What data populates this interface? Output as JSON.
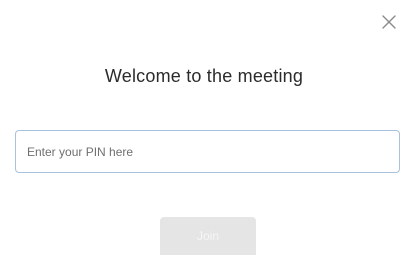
{
  "dialog": {
    "close_icon": "close-icon",
    "title": "Welcome to the meeting",
    "pin_input": {
      "value": "",
      "placeholder": "Enter your PIN here"
    },
    "join_label": "Join",
    "join_disabled": true
  },
  "colors": {
    "input_border": "#a9c1dd",
    "join_background": "#e5e5e5",
    "close_icon": "#8a8a8a"
  }
}
